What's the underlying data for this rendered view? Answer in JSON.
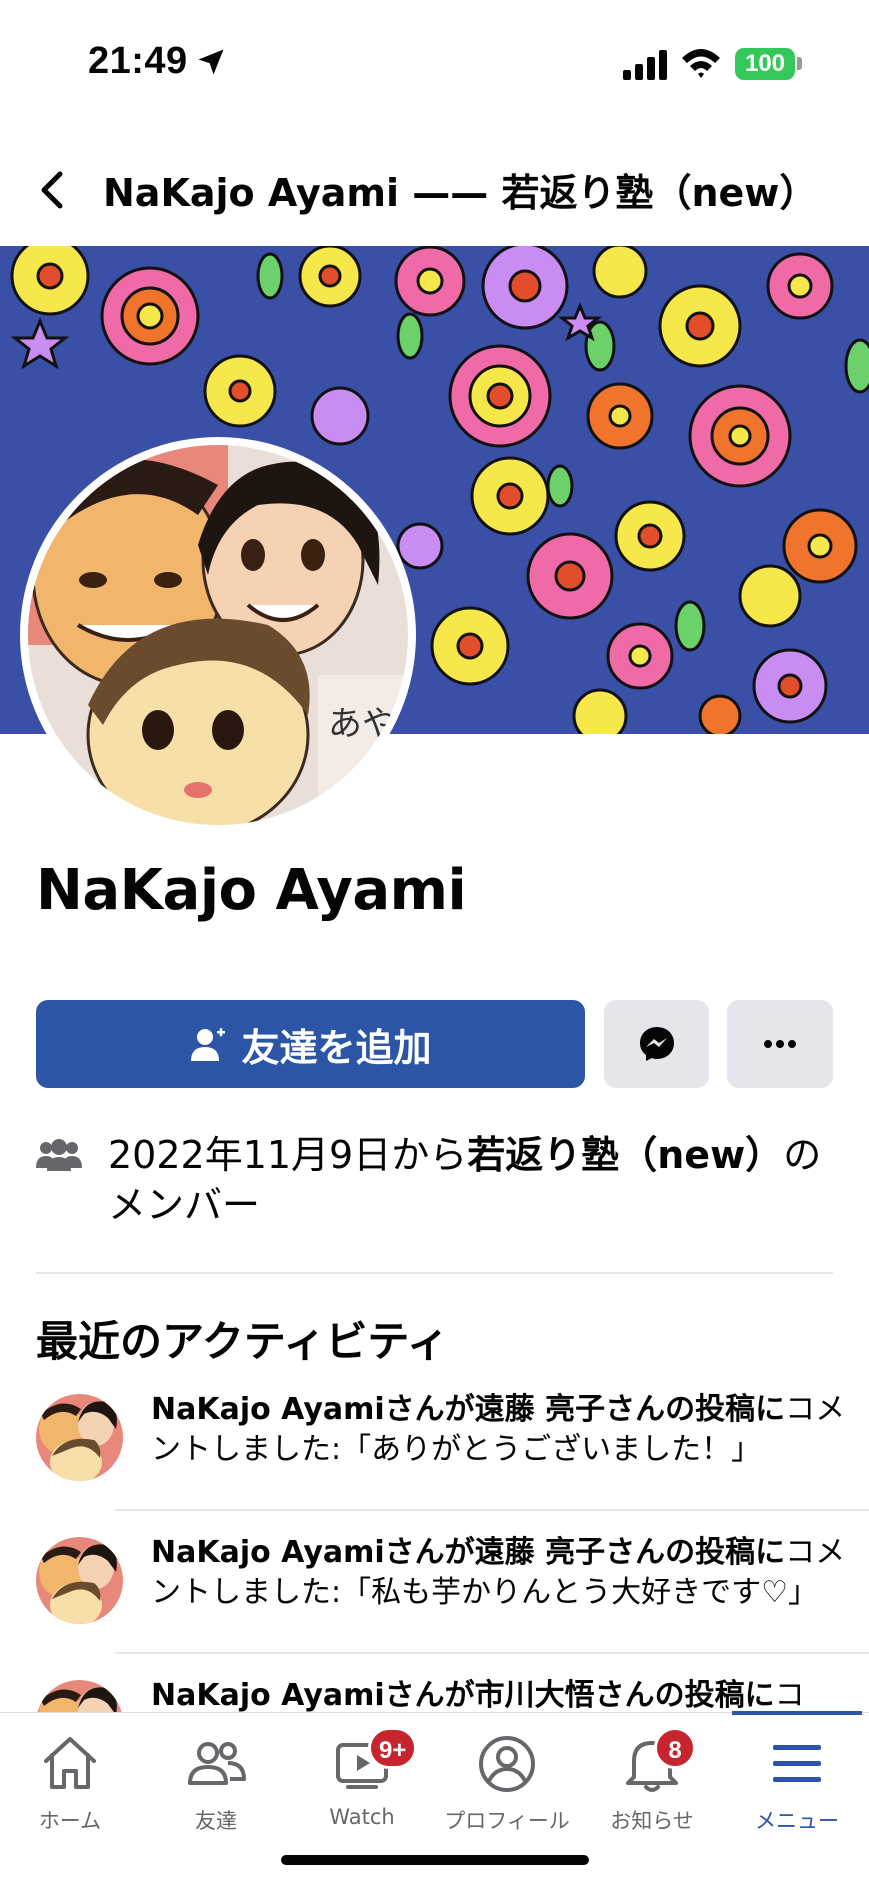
{
  "status_bar": {
    "time": "21:49",
    "battery": "100"
  },
  "header": {
    "title": "NaKajo Ayami —— 若返り塾（new）"
  },
  "profile": {
    "name": "NaKajo Ayami",
    "add_friend_label": "友達を追加"
  },
  "membership": {
    "prefix": "2022年11月9日から",
    "group": "若返り塾（new）",
    "suffix": "のメンバー"
  },
  "recent": {
    "title": "最近のアクティビティ",
    "items": [
      {
        "bold": "NaKajo Ayamiさんが遠藤 亮子さんの投稿に",
        "rest": "コメントしました:「ありがとうございました！」"
      },
      {
        "bold": "NaKajo Ayamiさんが遠藤 亮子さんの投稿に",
        "rest": "コメントしました:「私も芋かりんとう大好きです♡」"
      },
      {
        "bold": "NaKajo Ayamiさんが市川大悟さんの投稿に",
        "rest": "コ"
      }
    ]
  },
  "tabbar": {
    "items": [
      {
        "label": "ホーム",
        "icon": "home-icon"
      },
      {
        "label": "友達",
        "icon": "friends-icon"
      },
      {
        "label": "Watch",
        "icon": "watch-icon",
        "badge": "9+"
      },
      {
        "label": "プロフィール",
        "icon": "profile-icon"
      },
      {
        "label": "お知らせ",
        "icon": "bell-icon",
        "badge": "8"
      },
      {
        "label": "メニュー",
        "icon": "menu-icon",
        "active": true
      }
    ]
  },
  "colors": {
    "primary": "#2d55a5",
    "badge": "#c6242f",
    "secondary_button": "#e4e6eb",
    "cover_bg": "#3a4fa6"
  }
}
